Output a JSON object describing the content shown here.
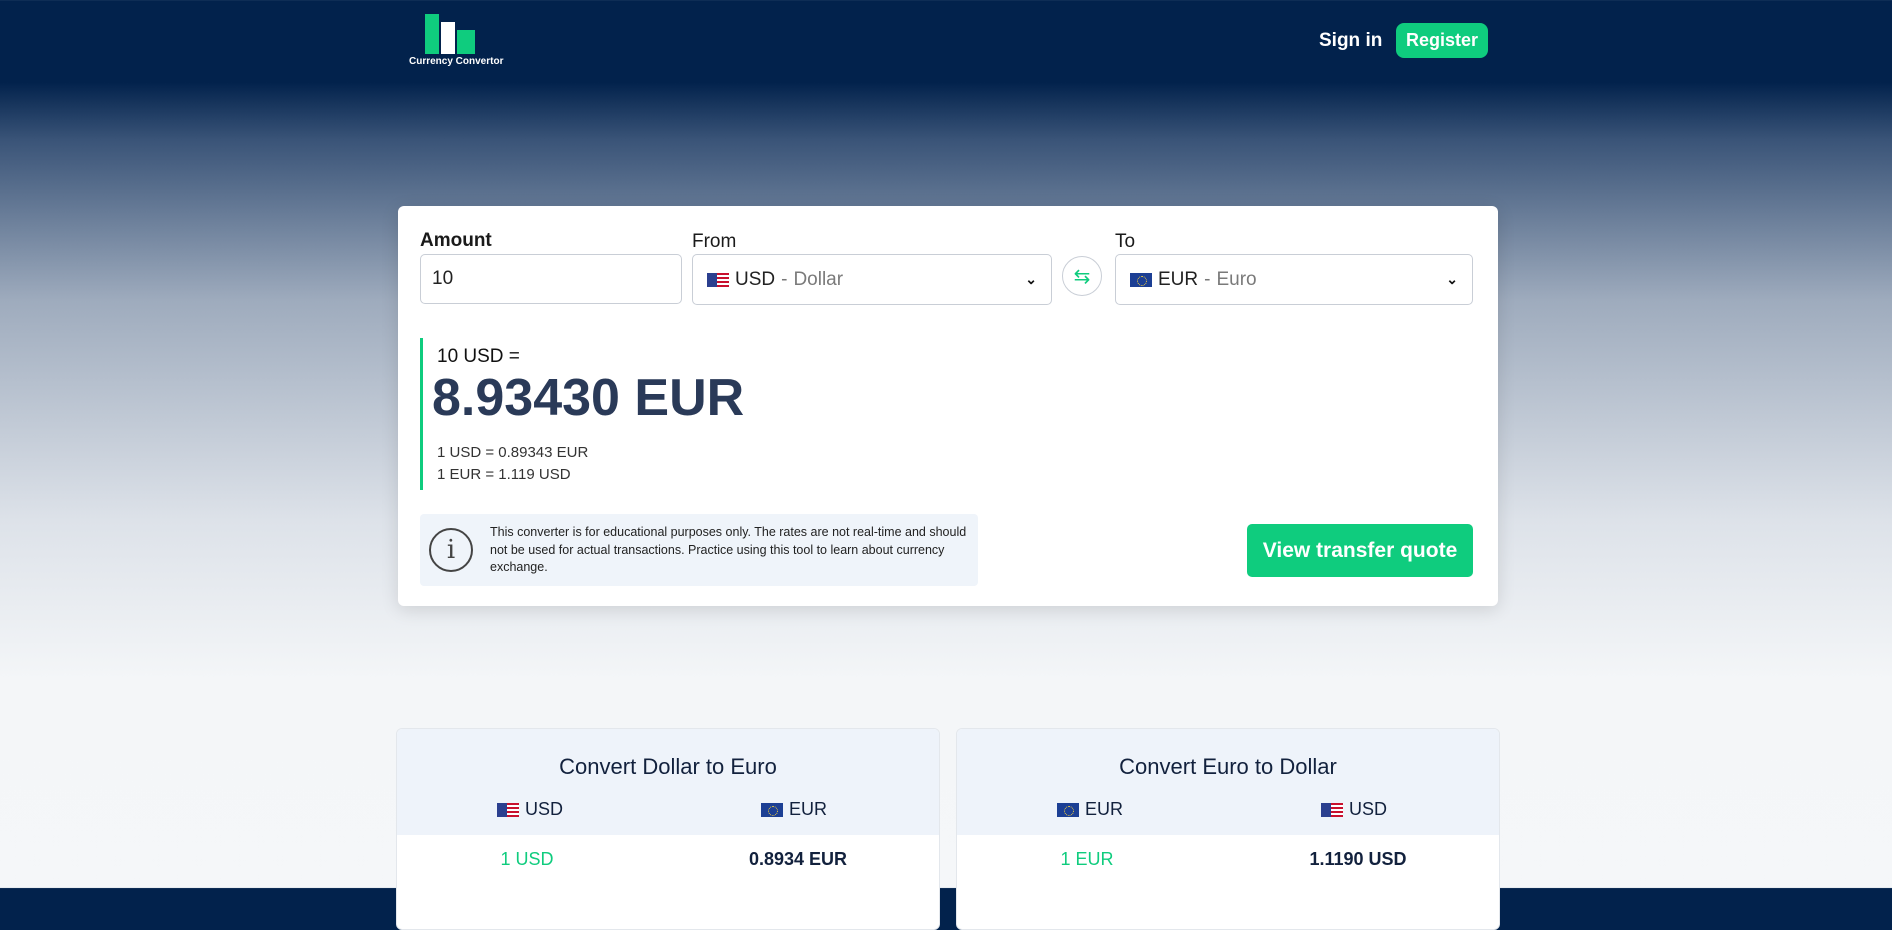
{
  "header": {
    "logo_text": "Currency Convertor",
    "signin_label": "Sign in",
    "register_label": "Register"
  },
  "converter": {
    "amount_label": "Amount",
    "amount_value": "10",
    "from_label": "From",
    "from_code": "USD",
    "from_name": "Dollar",
    "to_label": "To",
    "to_code": "EUR",
    "to_name": "Euro",
    "separator": "-",
    "result_from": "10 USD =",
    "result_main": "8.93430 EUR",
    "rate_line_1": "1 USD = 0.89343 EUR",
    "rate_line_2": "1 EUR = 1.119 USD",
    "notice_text": "This converter is for educational purposes only. The rates are not real-time and should not be used for actual transactions. Practice using this tool to learn about currency exchange.",
    "quote_button_label": "View transfer quote"
  },
  "tables": [
    {
      "title": "Convert Dollar to Euro",
      "col_a": "USD",
      "col_b": "EUR",
      "rows": [
        {
          "a": "1 USD",
          "b": "0.8934 EUR"
        }
      ]
    },
    {
      "title": "Convert Euro to Dollar",
      "col_a": "EUR",
      "col_b": "USD",
      "rows": [
        {
          "a": "1 EUR",
          "b": "1.1190 USD"
        }
      ]
    }
  ],
  "colors": {
    "accent": "#0fcc7e",
    "header_bg": "#02224c",
    "result_text": "#2a3a58"
  },
  "icons": [
    "logo-bars-icon",
    "us-flag-icon",
    "eu-flag-icon",
    "chevron-down-icon",
    "swap-icon",
    "info-icon"
  ]
}
